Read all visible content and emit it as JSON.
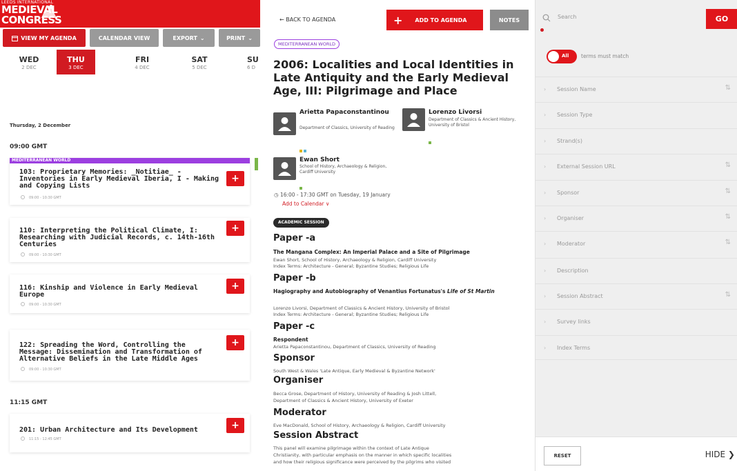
{
  "brand": {
    "line1": "LEEDS INTERNATIONAL",
    "line2": "MEDIEVAL",
    "line3": "CONGRESS",
    "color": "#e0161b"
  },
  "toolbar": {
    "view_my_agenda": "VIEW MY AGENDA",
    "calendar_view": "CALENDAR VIEW",
    "export": "EXPORT",
    "print": "PRINT"
  },
  "days": [
    {
      "name": "WED",
      "date": "2 DEC",
      "active": false
    },
    {
      "name": "THU",
      "date": "3 DEC",
      "active": true
    },
    {
      "name": "FRI",
      "date": "4 DEC",
      "active": false
    },
    {
      "name": "SAT",
      "date": "5 DEC",
      "active": false
    },
    {
      "name": "SU",
      "date": "6 D",
      "active": false
    }
  ],
  "schedule": {
    "date_heading": "Thursday, 2 December",
    "time_0900": "09:00 GMT",
    "time_1115": "11:15 GMT",
    "strand_tag": "MEDITERRANEAN WORLD",
    "sessions": [
      {
        "title": "103: Proprietary Memories: _Notitiae_ - Inventories in Early Medieval Iberia, I - Making and Copying Lists",
        "time": "09:00 - 10:30 GMT"
      },
      {
        "title": "110: Interpreting the Political Climate, I: Researching with Judicial Records, c. 14th-16th Centuries",
        "time": "09:00 - 10:30 GMT"
      },
      {
        "title": "116: Kinship and Violence in Early Medieval Europe",
        "time": "09:00 - 10:30 GMT"
      },
      {
        "title": "122: Spreading the Word, Controlling the Message: Dissemination and Transformation of Alternative Beliefs in the Late Middle Ages",
        "time": "09:00 - 10:30 GMT"
      },
      {
        "title": "201: Urban Architecture and Its Development",
        "time": "11:15 - 12:45 GMT"
      }
    ],
    "plus": "+"
  },
  "detail": {
    "back": "← BACK TO AGENDA",
    "add_to_agenda": "ADD TO AGENDA",
    "add_plus": "+",
    "notes": "NOTES",
    "strand": "MEDITERRANEAN WORLD",
    "title": "2006: Localities and Local Identities in Late Antiquity and the Early Medieval Age, III: Pilgrimage and Place",
    "people": [
      {
        "name": "Arietta Papaconstantinou",
        "affiliation": "Department of Classics, University of Reading",
        "dot1": "#e0b400",
        "dot2": "#5ab4d6"
      },
      {
        "name": "Lorenzo Livorsi",
        "affiliation": "Department of Classics & Ancient History, University of Bristol",
        "dot1": "#7ab648",
        "dot2": ""
      },
      {
        "name": "Ewan Short",
        "affiliation": "School of History, Archaeology & Religion, Cardiff University",
        "dot1": "#7ab648",
        "dot2": ""
      }
    ],
    "time": "16:00 - 17:30 GMT on Tuesday, 19 January",
    "add_to_calendar": "Add to Calendar ∨",
    "session_type": "ACADEMIC SESSION",
    "paper_a": "Paper -a",
    "paper_a_title": "The Mangana Complex: An Imperial Palace and a Site of Pilgrimage",
    "paper_a_author": "Ewan Short, School of History, Archaeology & Religion, Cardiff University",
    "paper_a_index": "Index Terms: Architecture - General; Byzantine Studies; Religious Life",
    "paper_b": "Paper -b",
    "paper_b_title_1": "Hagiography and Autobiography of Venantius Fortunatus's ",
    "paper_b_title_em": "Life of St Martin",
    "paper_b_author": "Lorenzo Livorsi, Department of Classics & Ancient History, University of Bristol",
    "paper_b_index": "Index Terms: Architecture - General; Byzantine Studies; Religious Life",
    "paper_c": "Paper -c",
    "respondent_label": "Respondent",
    "respondent": "Arietta Papaconstantinou, Department of Classics, University of Reading",
    "sponsor_label": "Sponsor",
    "sponsor": "South West & Wales 'Late Antique, Early Medieval & Byzantine Network'",
    "organiser_label": "Organiser",
    "organiser_1": "Becca Grose, Department of History, University of Reading & Josh Littell,",
    "organiser_2": "Department of Classics & Ancient History, University of Exeter",
    "moderator_label": "Moderator",
    "moderator": "Eve MacDonald, School of History, Archaeology & Religion, Cardiff University",
    "abstract_label": "Session Abstract",
    "abstract_1": "This panel will examine pilgrimage within the context of Late Antique",
    "abstract_2": "Christianity, with particular emphasis on the manner in which specific localities",
    "abstract_3": "and how their religious significance were perceived by the pilgrims who visited"
  },
  "filters": {
    "search_placeholder": "Search",
    "go": "GO",
    "toggle_label": "All",
    "terms_must_match": "terms must match",
    "fields": [
      "Session Name",
      "Session Type",
      "Strand(s)",
      "External Session URL",
      "Sponsor",
      "Organiser",
      "Moderator",
      "Description",
      "Session Abstract",
      "Survey links",
      "Index Terms"
    ],
    "reset": "RESET",
    "hide": "HIDE ❯"
  }
}
